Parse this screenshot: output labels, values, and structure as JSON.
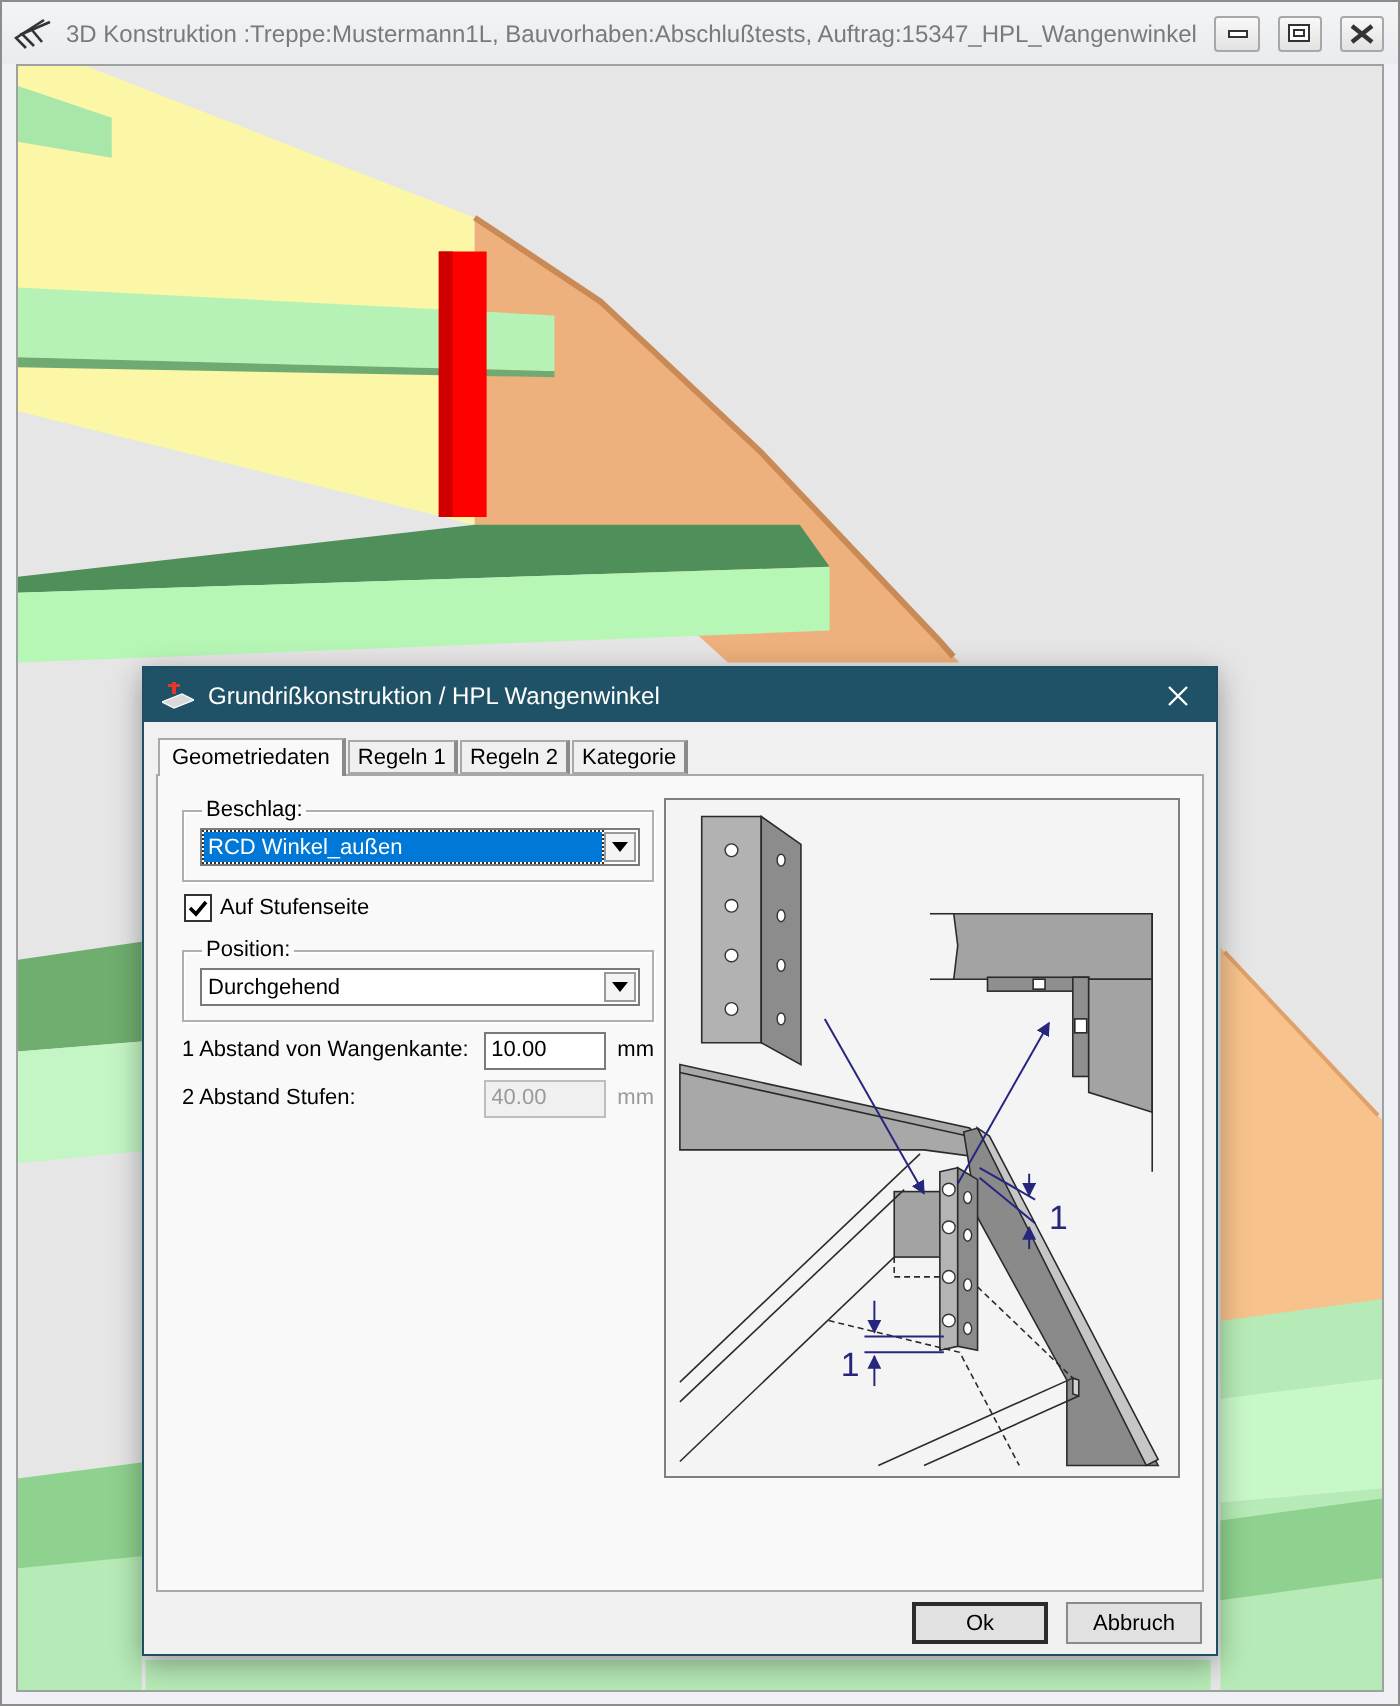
{
  "window": {
    "title": "3D Konstruktion :Treppe:Mustermann1L, Bauvorhaben:Abschlußtests, Auftrag:15347_HPL_Wangenwinkel"
  },
  "dialog": {
    "title": "Grundrißkonstruktion / HPL Wangenwinkel",
    "tabs": [
      {
        "label": "Geometriedaten",
        "selected": true
      },
      {
        "label": "Regeln 1",
        "selected": false
      },
      {
        "label": "Regeln 2",
        "selected": false
      },
      {
        "label": "Kategorie",
        "selected": false
      }
    ],
    "beschlag": {
      "label": "Beschlag:",
      "value": "RCD Winkel_außen",
      "focused": true
    },
    "checkbox": {
      "label": "Auf Stufenseite",
      "checked": true
    },
    "position": {
      "label": "Position:",
      "value": "Durchgehend",
      "focused": false
    },
    "fields": [
      {
        "label": "1 Abstand von Wangenkante:",
        "value": "10.00",
        "unit": "mm",
        "disabled": false
      },
      {
        "label": "2 Abstand Stufen:",
        "value": "40.00",
        "unit": "mm",
        "disabled": true
      }
    ],
    "dimension_labels": [
      "1",
      "1"
    ],
    "buttons": [
      {
        "label": "Ok",
        "default": true
      },
      {
        "label": "Abbruch",
        "default": false
      }
    ]
  }
}
